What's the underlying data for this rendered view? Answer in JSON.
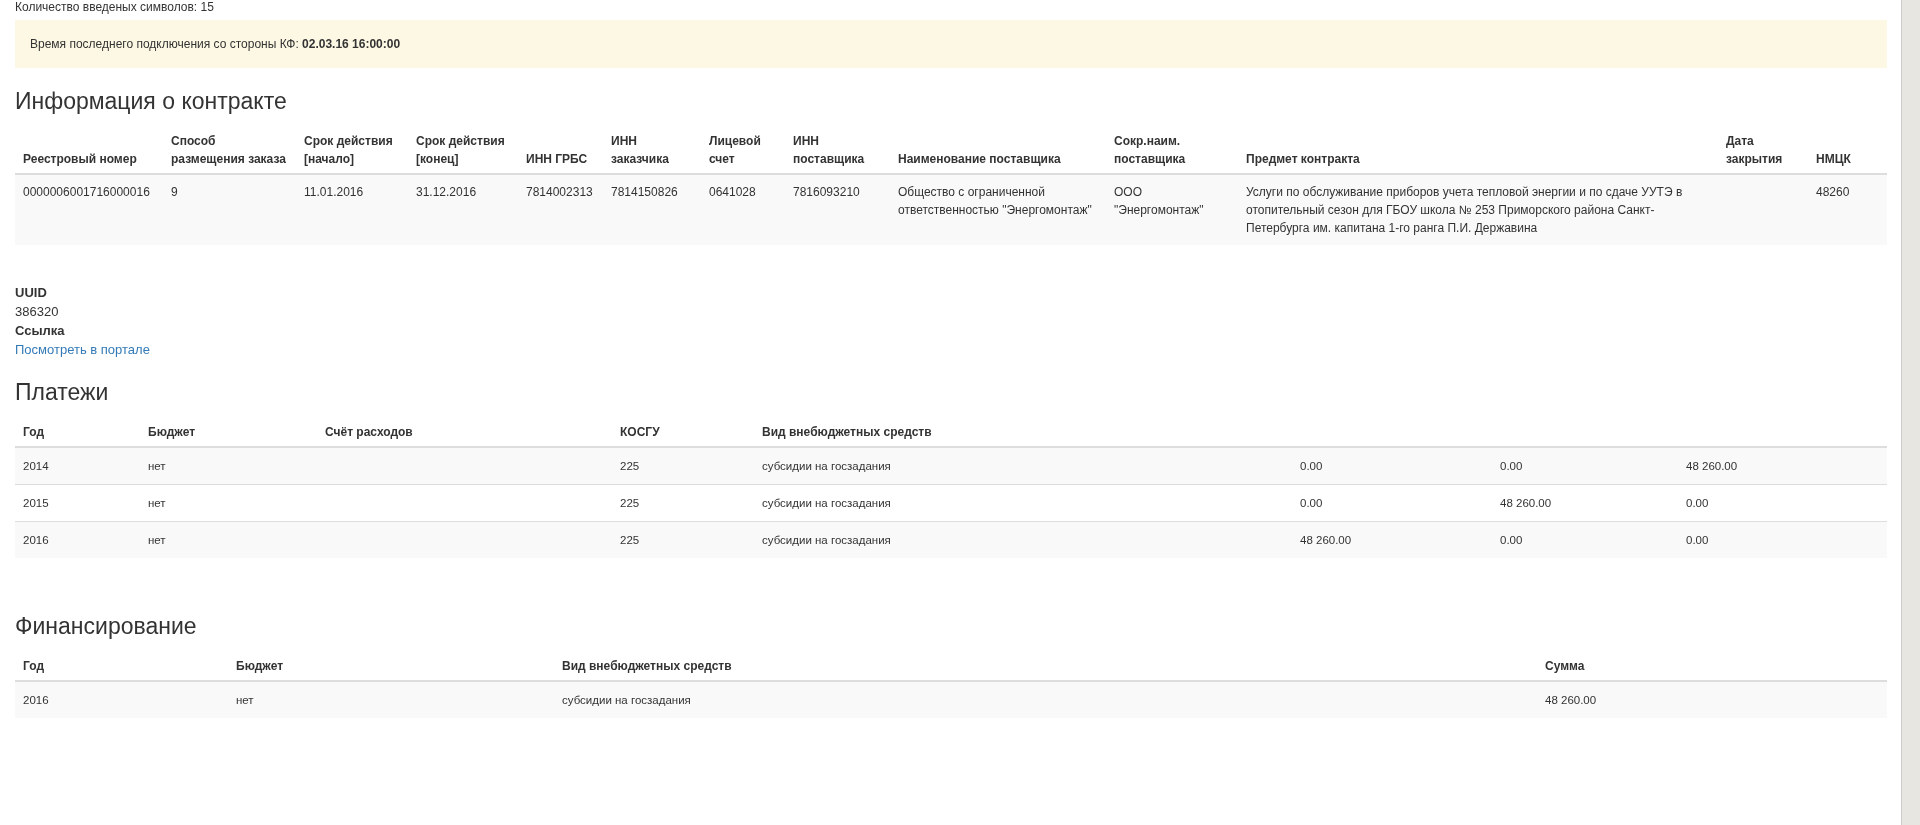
{
  "top_note": "Количество введеных символов: 15",
  "alert": {
    "label": "Время последнего подключения со стороны КФ:",
    "value": "02.03.16 16:00:00"
  },
  "contract": {
    "title": "Информация о контракте",
    "columns": [
      "Реестровый номер",
      "Способ размещения заказа",
      "Срок действия [начало]",
      "Срок действия [конец]",
      "ИНН ГРБС",
      "ИНН заказчика",
      "Лицевой счет",
      "ИНН поставщика",
      "Наименование поставщика",
      "Сокр.наим. поставщика",
      "Предмет контракта",
      "Дата закрытия",
      "НМЦК"
    ],
    "rows": [
      [
        "0000006001716000016",
        "9",
        "11.01.2016",
        "31.12.2016",
        "7814002313",
        "7814150826",
        "0641028",
        "7816093210",
        "Общество с ограниченной ответственностью \"Энергомонтаж\"",
        "ООО \"Энергомонтаж\"",
        "Услуги по обслуживание приборов учета тепловой энергии и по сдаче УУТЭ в отопительный сезон для ГБОУ школа № 253 Приморского района Санкт-Петербурга им. капитана 1-го ранга П.И. Державина",
        "",
        "48260"
      ]
    ]
  },
  "details": [
    {
      "label": "UUID",
      "value": "386320",
      "kind": "text"
    },
    {
      "label": "Ссылка",
      "value": "Посмотреть в портале",
      "kind": "link"
    }
  ],
  "payments": {
    "title": "Платежи",
    "columns": [
      "Год",
      "Бюджет",
      "Счёт расходов",
      "КОСГУ",
      "Вид внебюджетных средств",
      "",
      "",
      ""
    ],
    "rows": [
      [
        "2014",
        "нет",
        "",
        "225",
        "субсидии на госзадания",
        "0.00",
        "0.00",
        "48 260.00"
      ],
      [
        "2015",
        "нет",
        "",
        "225",
        "субсидии на госзадания",
        "0.00",
        "48 260.00",
        "0.00"
      ],
      [
        "2016",
        "нет",
        "",
        "225",
        "субсидии на госзадания",
        "48 260.00",
        "0.00",
        "0.00"
      ]
    ]
  },
  "financing": {
    "title": "Финансирование",
    "columns": [
      "Год",
      "Бюджет",
      "Вид внебюджетных средств",
      "Сумма"
    ],
    "rows": [
      [
        "2016",
        "нет",
        "субсидии на госзадания",
        "48 260.00"
      ]
    ]
  }
}
